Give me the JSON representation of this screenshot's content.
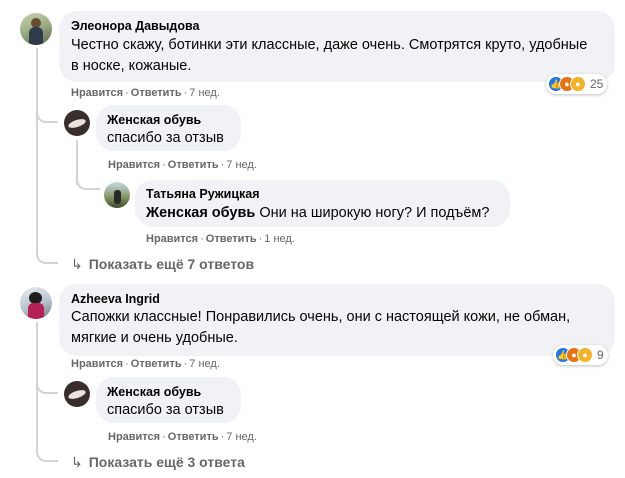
{
  "comments": [
    {
      "author": "Элеонора Давыдова",
      "text_line1": "Честно скажу, ботинки эти классные, даже очень. Смотрятся круто, удобные",
      "text_line2": "в носке, кожаные.",
      "like_label": "Нравится",
      "reply_label": "Ответить",
      "time": "7 нед.",
      "reaction_count": "25",
      "reaction_icons": [
        "like-icon",
        "angry-icon",
        "wow-icon"
      ],
      "reply": {
        "author": "Женская обувь",
        "text": "спасибо за отзыв",
        "like_label": "Нравится",
        "reply_label": "Ответить",
        "time": "7 нед."
      },
      "subreply": {
        "author": "Татьяна Ружицкая",
        "mention": "Женская обувь",
        "text": "Они на широкую ногу? И подъём?",
        "like_label": "Нравится",
        "reply_label": "Ответить",
        "time": "1 нед."
      },
      "more_replies": "Показать ещё 7 ответов"
    },
    {
      "author": "Azheeva Ingrid",
      "text_line1": "Сапожки классные! Понравились очень, они с настоящей кожи, не обман,",
      "text_line2": "мягкие и очень удобные.",
      "like_label": "Нравится",
      "reply_label": "Ответить",
      "time": "7 нед.",
      "reaction_count": "9",
      "reaction_icons": [
        "like-icon",
        "angry-icon",
        "wow-icon"
      ],
      "reply": {
        "author": "Женская обувь",
        "text": "спасибо за отзыв",
        "like_label": "Нравится",
        "reply_label": "Ответить",
        "time": "7 нед."
      },
      "more_replies": "Показать ещё 3 ответа"
    }
  ],
  "separator": "·",
  "colors": {
    "bubble": "#f0f2f5",
    "meta": "#65676b",
    "like": "#1877f2",
    "wow": "#f7b125",
    "angry": "#e9710f"
  }
}
